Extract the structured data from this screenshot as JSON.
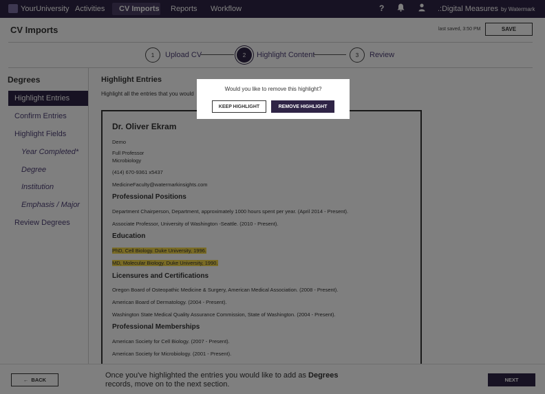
{
  "topbar": {
    "brand": "YourUniversity",
    "nav": [
      "Activities",
      "CV Imports",
      "Reports",
      "Workflow"
    ],
    "help_icon": "help-icon",
    "bell_icon": "bell-icon",
    "user_icon": "user-icon",
    "product": ".:Digital Measures",
    "by": "by Watermark"
  },
  "header": {
    "title": "CV Imports",
    "last_saved": "last saved, 3:50 PM",
    "save_label": "SAVE"
  },
  "steps": [
    {
      "num": "1",
      "label": "Upload CV"
    },
    {
      "num": "2",
      "label": "Highlight Content"
    },
    {
      "num": "3",
      "label": "Review"
    }
  ],
  "sidebar": {
    "title": "Degrees",
    "items": [
      "Highlight Entries",
      "Confirm Entries",
      "Highlight Fields",
      "Year Completed*",
      "Degree",
      "Institution",
      "Emphasis / Major",
      "Review Degrees"
    ]
  },
  "main": {
    "title": "Highlight Entries",
    "description": "Highlight all the entries that you would"
  },
  "document": {
    "name": "Dr. Oliver Ekram",
    "line1": "Demo",
    "line2": "Full Professor",
    "line3": "Microbiology",
    "phone": "(414) 670-9361 x5437",
    "email": "MedicineFaculty@watermarkinsights.com",
    "sections": {
      "positions_title": "Professional Positions",
      "positions": [
        "Department Chairperson, Department, approximately 1000 hours spent per year. (April 2014 - Present).",
        "Associate Professor, University of Washington -Seattle. (2010 - Present)."
      ],
      "education_title": "Education",
      "education": [
        "PhD, Cell Biology. Duke University, 1996.",
        "MD, Molecular Biology. Duke University, 1990."
      ],
      "licensures_title": "Licensures and Certifications",
      "licensures": [
        "Oregon Board of Osteopathic Medicine & Surgery, American Medical Association. (2008 - Present).",
        "American Board of Dermatology. (2004 - Present).",
        "Washington State Medical Quality Assurance Commission, State of Washington. (2004 - Present)."
      ],
      "memberships_title": "Professional Memberships",
      "memberships": [
        "American Society for Cell Biology. (2007 - Present).",
        "American Society for Microbiology. (2001 - Present)."
      ]
    }
  },
  "footer": {
    "back_label": "BACK",
    "message_pre": "Once you've highlighted the entries you would like to add as ",
    "message_bold": "Degrees",
    "message_post": " records, move on to the next section.",
    "next_label": "NEXT"
  },
  "modal": {
    "question": "Would you like to remove this highlight?",
    "keep_label": "KEEP HIGHLIGHT",
    "remove_label": "REMOVE HIGHLIGHT"
  },
  "colors": {
    "brand": "#2f2446",
    "accent_text": "#4d3f74",
    "highlight": "#f2d64b"
  }
}
